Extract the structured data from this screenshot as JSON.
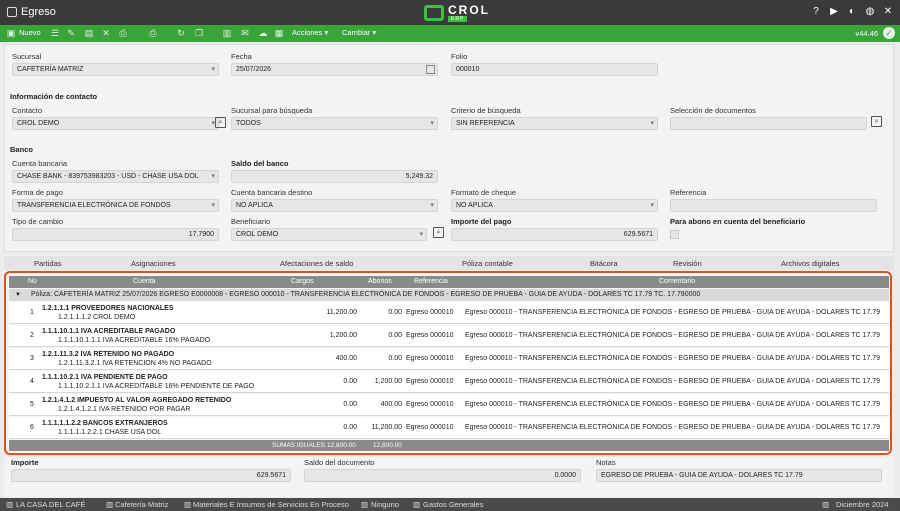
{
  "window": {
    "title": "Egreso",
    "logo_word": "CROL",
    "logo_sub": "ERP"
  },
  "toolbar": {
    "new_label": "Nuevo",
    "actions_label": "Acciones",
    "change_label": "Cambiar",
    "version": "v44.46"
  },
  "header": {
    "sucursal_label": "Sucursal",
    "sucursal_value": "CAFETERÍA MATRIZ",
    "fecha_label": "Fecha",
    "fecha_value": "25/07/2026",
    "folio_label": "Folio",
    "folio_value": "000010"
  },
  "contact": {
    "section": "Información de contacto",
    "contacto_label": "Contacto",
    "contacto_value": "CROL DEMO",
    "sucursal_busq_label": "Sucursal para búsqueda",
    "sucursal_busq_value": "TODOS",
    "criterio_label": "Criterio de búsqueda",
    "criterio_value": "SIN REFERENCIA",
    "seleccion_label": "Selección de documentos",
    "seleccion_value": ""
  },
  "bank": {
    "section": "Banco",
    "cuenta_label": "Cuenta bancaria",
    "cuenta_value": "CHASE BANK - 839753983203 - USD - CHASE USA DOL",
    "saldo_label": "Saldo del banco",
    "saldo_value": "5,249.32",
    "forma_label": "Forma de pago",
    "forma_value": "TRANSFERENCIA ELECTRÓNICA DE FONDOS",
    "destino_label": "Cuenta bancaria destino",
    "destino_value": "NO APLICA",
    "cheque_label": "Formato de cheque",
    "cheque_value": "NO APLICA",
    "referencia_label": "Referencia",
    "referencia_value": "",
    "tipo_label": "Tipo de cambio",
    "tipo_value": "17.7900",
    "beneficiario_label": "Beneficiario",
    "beneficiario_value": "CROL DEMO",
    "importe_label": "Importe del pago",
    "importe_value": "629.5671",
    "abono_label": "Para abono en cuenta del beneficiario"
  },
  "tabs": [
    "Partidas",
    "Asignaciones",
    "Afectaciones de saldo",
    "Póliza contable",
    "Bitácora",
    "Revisión",
    "Archivos digitales"
  ],
  "grid": {
    "columns": {
      "no": "No",
      "cuenta": "Cuenta",
      "cargos": "Cargos",
      "abonos": "Abonos",
      "referencia": "Referencia",
      "comentario": "Comentario"
    },
    "poliza": "Póliza: CAFETERÍA MATRIZ 25/07/2026 EGRESO E0000008 - EGRESO 000010 - TRANSFERENCIA ELECTRÓNICA DE FONDOS - EGRESO DE PRUEBA - GUIA DE AYUDA - DOLARES TC 17.79 TC. 17.790000",
    "rows": [
      {
        "no": "1",
        "name": "1.2.1.1.1 PROVEEDORES NACIONALES",
        "sub": "1.2.1.1.1.2 CROL DEMO",
        "cargos": "11,200.00",
        "abonos": "0.00",
        "ref": "Egreso 000010",
        "com": "Egreso 000010 - TRANSFERENCIA ELECTRÓNICA DE FONDOS - EGRESO DE PRUEBA - GUIA DE AYUDA - DOLARES TC 17.79"
      },
      {
        "no": "2",
        "name": "1.1.1.10.1.1 IVA ACREDITABLE PAGADO",
        "sub": "1.1.1.10.1.1.1 IVA ACREDITABLE 16% PAGADO",
        "cargos": "1,200.00",
        "abonos": "0.00",
        "ref": "Egreso 000010",
        "com": "Egreso 000010 - TRANSFERENCIA ELECTRÓNICA DE FONDOS - EGRESO DE PRUEBA - GUIA DE AYUDA - DOLARES TC 17.79"
      },
      {
        "no": "3",
        "name": "1.2.1.11.3.2 IVA RETENIDO NO PAGADO",
        "sub": "1.2.1.11.3.2.1 IVA RETENCION 4% NO PAGADO",
        "cargos": "400.00",
        "abonos": "0.00",
        "ref": "Egreso 000010",
        "com": "Egreso 000010 - TRANSFERENCIA ELECTRÓNICA DE FONDOS - EGRESO DE PRUEBA - GUIA DE AYUDA - DOLARES TC 17.79"
      },
      {
        "no": "4",
        "name": "1.1.1.10.2.1 IVA PENDIENTE DE PAGO",
        "sub": "1.1.1.10.2.1.1 IVA ACREDITABLE 16% PENDIENTE DE PAGO",
        "cargos": "0.00",
        "abonos": "1,200.00",
        "ref": "Egreso 000010",
        "com": "Egreso 000010 - TRANSFERENCIA ELECTRÓNICA DE FONDOS - EGRESO DE PRUEBA - GUIA DE AYUDA - DOLARES TC 17.79"
      },
      {
        "no": "5",
        "name": "1.2.1.4.1.2 IMPUESTO AL VALOR AGREGADO RETENIDO",
        "sub": "1.2.1.4.1.2.1 IVA RETENIDO POR PAGAR",
        "cargos": "0.00",
        "abonos": "400.00",
        "ref": "Egreso 000010",
        "com": "Egreso 000010 - TRANSFERENCIA ELECTRÓNICA DE FONDOS - EGRESO DE PRUEBA - GUIA DE AYUDA - DOLARES TC 17.79"
      },
      {
        "no": "6",
        "name": "1.1.1.1.1.2.2 BANCOS EXTRANJEROS",
        "sub": "1.1.1.1.1.2.2.1 CHASE USA DOL",
        "cargos": "0.00",
        "abonos": "11,200.00",
        "ref": "Egreso 000010",
        "com": "Egreso 000010 - TRANSFERENCIA ELECTRÓNICA DE FONDOS - EGRESO DE PRUEBA - GUIA DE AYUDA - DOLARES TC 17.79"
      }
    ],
    "footer_label": "SUMAS IGUALES",
    "footer_cargos": "12,800.00",
    "footer_abonos": "12,800.00"
  },
  "totals": {
    "importe_label": "Importe",
    "importe_value": "629.5671",
    "saldo_doc_label": "Saldo del documento",
    "saldo_doc_value": "0.0000",
    "notas_label": "Notas",
    "notas_value": "EGRESO DE PRUEBA - GUIA DE AYUDA - DOLARES TC 17.79"
  },
  "status": {
    "company": "LA CASA DEL CAFÉ",
    "branch": "Cafetería Matriz",
    "category": "Materiales E Insumos de Servicios En Proceso",
    "none": "Ninguno",
    "expense": "Gastos Generales",
    "period": "Diciembre 2024"
  }
}
